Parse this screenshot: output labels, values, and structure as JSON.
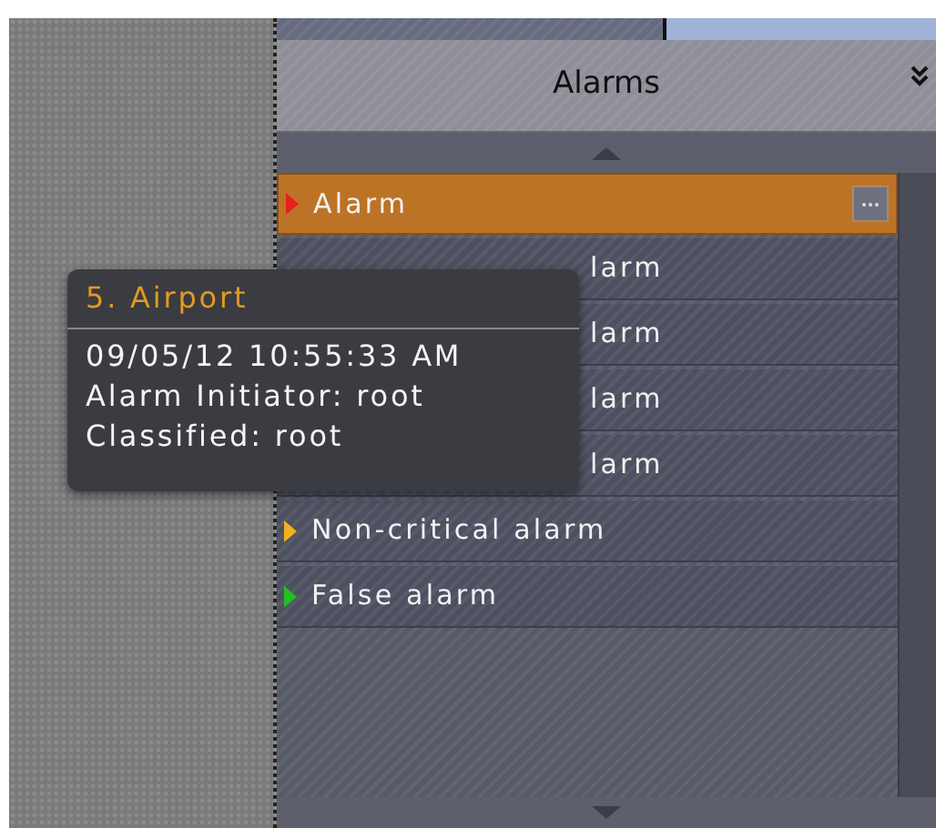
{
  "panel": {
    "title": "Alarms"
  },
  "alarms": [
    {
      "label": "Alarm",
      "color": "#e8201c",
      "selected": true,
      "covered": false
    },
    {
      "label": "larm",
      "selected": false,
      "covered": true
    },
    {
      "label": "larm",
      "selected": false,
      "covered": true
    },
    {
      "label": "larm",
      "selected": false,
      "covered": true
    },
    {
      "label": "larm",
      "selected": false,
      "covered": true
    },
    {
      "label": "Non-critical alarm",
      "color": "#f2b21b",
      "selected": false,
      "covered": false
    },
    {
      "label": "False alarm",
      "color": "#22c022",
      "selected": false,
      "covered": false
    }
  ],
  "tooltip": {
    "title": "5. Airport",
    "lines": [
      "09/05/12 10:55:33 AM",
      "Alarm Initiator: root",
      "Classified: root"
    ]
  }
}
